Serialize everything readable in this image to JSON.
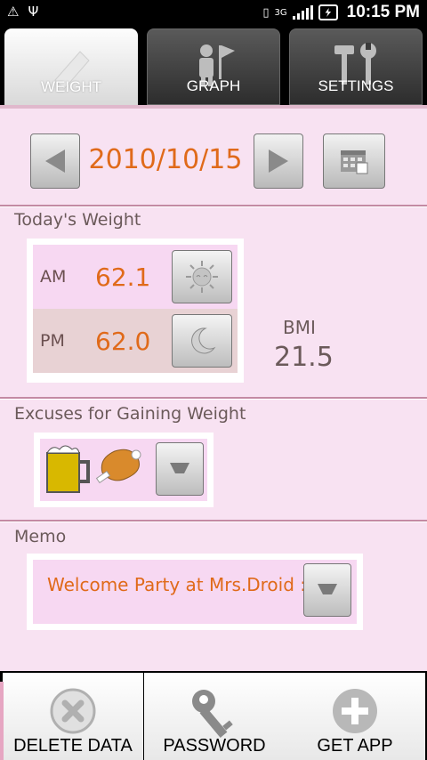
{
  "status_bar": {
    "clock": "10:15 PM",
    "network": "3G",
    "icons": [
      "warning-icon",
      "usb-icon",
      "vibrate-icon",
      "signal-icon",
      "battery-charging-icon"
    ]
  },
  "tabs": [
    {
      "label": "WEIGHT",
      "icon": "pencil-icon",
      "selected": true
    },
    {
      "label": "GRAPH",
      "icon": "person-flag-icon",
      "selected": false
    },
    {
      "label": "SETTINGS",
      "icon": "tools-icon",
      "selected": false
    }
  ],
  "date_nav": {
    "date": "2010/10/15",
    "prev_icon": "left-arrow-icon",
    "next_icon": "right-arrow-icon",
    "calendar_icon": "calendar-icon"
  },
  "today_weight": {
    "title": "Today's Weight",
    "am": {
      "label": "AM",
      "value": "62.1",
      "icon": "sun-icon"
    },
    "pm": {
      "label": "PM",
      "value": "62.0",
      "icon": "moon-icon"
    },
    "bmi_label": "BMI",
    "bmi_value": "21.5"
  },
  "excuses": {
    "title": "Excuses for Gaining Weight",
    "items": [
      "beer-icon",
      "meat-icon"
    ],
    "dropdown_icon": "chevron-down-icon"
  },
  "memo": {
    "title": "Memo",
    "text": "Welcome Party at Mrs.Droid :-)",
    "dropdown_icon": "chevron-down-icon"
  },
  "menu": [
    {
      "label": "DELETE DATA",
      "icon": "delete-icon"
    },
    {
      "label": "PASSWORD",
      "icon": "key-icon"
    },
    {
      "label": "GET APP",
      "icon": "plus-icon"
    }
  ],
  "colors": {
    "accent": "#e06a1a",
    "background": "#f8e2f2",
    "am_row": "#f7d8f2",
    "pm_row": "#e8d2d4"
  }
}
